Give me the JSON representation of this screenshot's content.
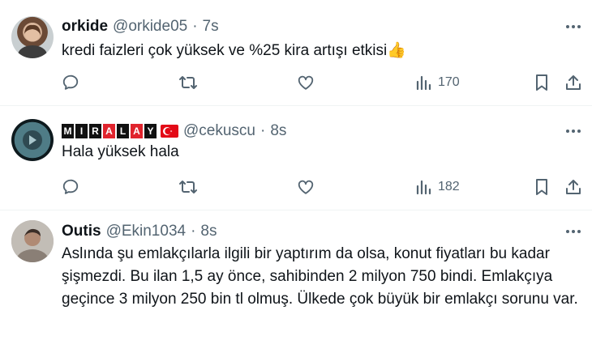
{
  "tweets": [
    {
      "name": "orkide",
      "handle": "@orkide05",
      "time": "7s",
      "text": "kredi faizleri çok yüksek ve %25 kira artışı etkisi👍",
      "views": "170"
    },
    {
      "name_badge_letters": [
        "M",
        "I",
        "R",
        "A",
        "L",
        "A",
        "Y"
      ],
      "handle": "@cekuscu",
      "time": "8s",
      "text": "Hala yüksek hala",
      "views": "182"
    },
    {
      "name": "Outis",
      "handle": "@Ekin1034",
      "time": "8s",
      "text_lines": [
        "Aslında şu emlakçılarla ilgili bir yaptırım da olsa, konut fiyatları bu kadar",
        "şişmezdi. Bu ilan 1,5 ay önce, sahibinden 2 milyon 750 bindi. Emlakçıya",
        "geçince 3 milyon 250 bin tl olmuş. Ülkede çok büyük bir emlakçı sorunu var."
      ]
    }
  ],
  "separator": "·",
  "icons": [
    "more-icon",
    "reply-icon",
    "retweet-icon",
    "like-icon",
    "views-icon",
    "bookmark-icon",
    "share-icon",
    "flag-turkey-icon"
  ],
  "colors": {
    "text": "#0f1419",
    "muted": "#536471",
    "divider": "#eff3f4",
    "flag_red": "#e30a17"
  }
}
